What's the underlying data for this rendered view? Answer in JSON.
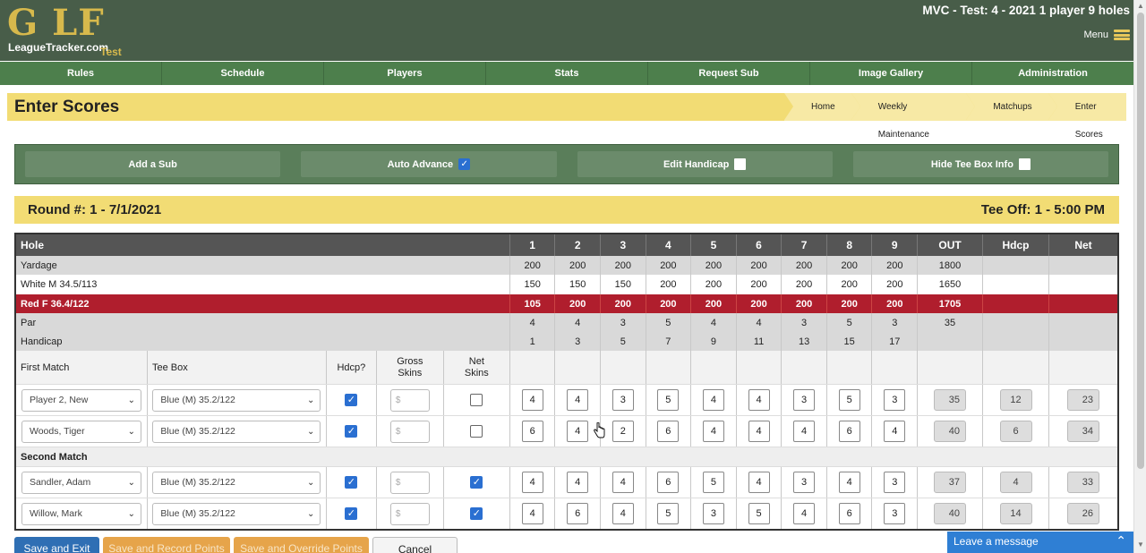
{
  "header": {
    "logo_golf": "G LF",
    "logo_site": "LeagueTracker.com",
    "logo_test": "Test",
    "title": "MVC - Test: 4 - 2021 1 player 9 holes",
    "menu_label": "Menu"
  },
  "nav": [
    "Rules",
    "Schedule",
    "Players",
    "Stats",
    "Request Sub",
    "Image Gallery",
    "Administration"
  ],
  "page_title": "Enter Scores",
  "breadcrumbs": [
    "Home",
    "Weekly Maintenance",
    "Matchups",
    "Enter Scores"
  ],
  "actions": {
    "add_sub": "Add a Sub",
    "auto_advance": "Auto Advance",
    "auto_advance_checked": true,
    "edit_handicap": "Edit Handicap",
    "edit_handicap_checked": false,
    "hide_tee_box": "Hide Tee Box Info",
    "hide_tee_box_checked": false
  },
  "round": {
    "left": "Round #: 1 - 7/1/2021",
    "right": "Tee Off: 1 - 5:00 PM"
  },
  "table": {
    "header": {
      "hole": "Hole",
      "holes": [
        "1",
        "2",
        "3",
        "4",
        "5",
        "6",
        "7",
        "8",
        "9"
      ],
      "out": "OUT",
      "hdcp": "Hdcp",
      "net": "Net"
    },
    "yardage": {
      "label": "Yardage",
      "values": [
        "200",
        "200",
        "200",
        "200",
        "200",
        "200",
        "200",
        "200",
        "200"
      ],
      "out": "1800"
    },
    "white": {
      "label": "White M 34.5/113",
      "values": [
        "150",
        "150",
        "150",
        "200",
        "200",
        "200",
        "200",
        "200",
        "200"
      ],
      "out": "1650"
    },
    "red": {
      "label": "Red F 36.4/122",
      "values": [
        "105",
        "200",
        "200",
        "200",
        "200",
        "200",
        "200",
        "200",
        "200"
      ],
      "out": "1705"
    },
    "par": {
      "label": "Par",
      "values": [
        "4",
        "4",
        "3",
        "5",
        "4",
        "4",
        "3",
        "5",
        "3"
      ],
      "out": "35"
    },
    "handicap": {
      "label": "Handicap",
      "values": [
        "1",
        "3",
        "5",
        "7",
        "9",
        "11",
        "13",
        "15",
        "17"
      ]
    },
    "subheader": {
      "first_match": "First Match",
      "tee_box": "Tee Box",
      "hdcp_q": "Hdcp?",
      "gross_1": "Gross",
      "gross_2": "Skins",
      "net_1": "Net",
      "net_2": "Skins"
    },
    "second_match": "Second Match",
    "money_placeholder": "$",
    "players": [
      {
        "name": "Player 2, New",
        "tee": "Blue (M) 35.2/122",
        "hdcp": true,
        "net_skins": false,
        "scores": [
          "4",
          "4",
          "3",
          "5",
          "4",
          "4",
          "3",
          "5",
          "3"
        ],
        "out": "35",
        "hdcp_val": "12",
        "net": "23"
      },
      {
        "name": "Woods, Tiger",
        "tee": "Blue (M) 35.2/122",
        "hdcp": true,
        "net_skins": false,
        "scores": [
          "6",
          "4",
          "2",
          "6",
          "4",
          "4",
          "4",
          "6",
          "4"
        ],
        "out": "40",
        "hdcp_val": "6",
        "net": "34"
      },
      {
        "name": "Sandler, Adam",
        "tee": "Blue (M) 35.2/122",
        "hdcp": true,
        "net_skins": true,
        "scores": [
          "4",
          "4",
          "4",
          "6",
          "5",
          "4",
          "3",
          "4",
          "3"
        ],
        "out": "37",
        "hdcp_val": "4",
        "net": "33"
      },
      {
        "name": "Willow, Mark",
        "tee": "Blue (M) 35.2/122",
        "hdcp": true,
        "net_skins": true,
        "scores": [
          "4",
          "6",
          "4",
          "5",
          "3",
          "5",
          "4",
          "6",
          "3"
        ],
        "out": "40",
        "hdcp_val": "14",
        "net": "26"
      }
    ]
  },
  "buttons": {
    "save_exit": "Save and Exit",
    "save_record": "Save and Record Points",
    "save_override": "Save and Override Points",
    "cancel": "Cancel"
  },
  "chat": {
    "label": "Leave a message"
  },
  "colors": {
    "header_bg": "#485d49",
    "nav_bg": "#4d7f4c",
    "title_yellow": "#f2dc74",
    "red_row": "#b01e2d",
    "primary_blue": "#2f6fb4",
    "orange": "#e6a44a"
  }
}
